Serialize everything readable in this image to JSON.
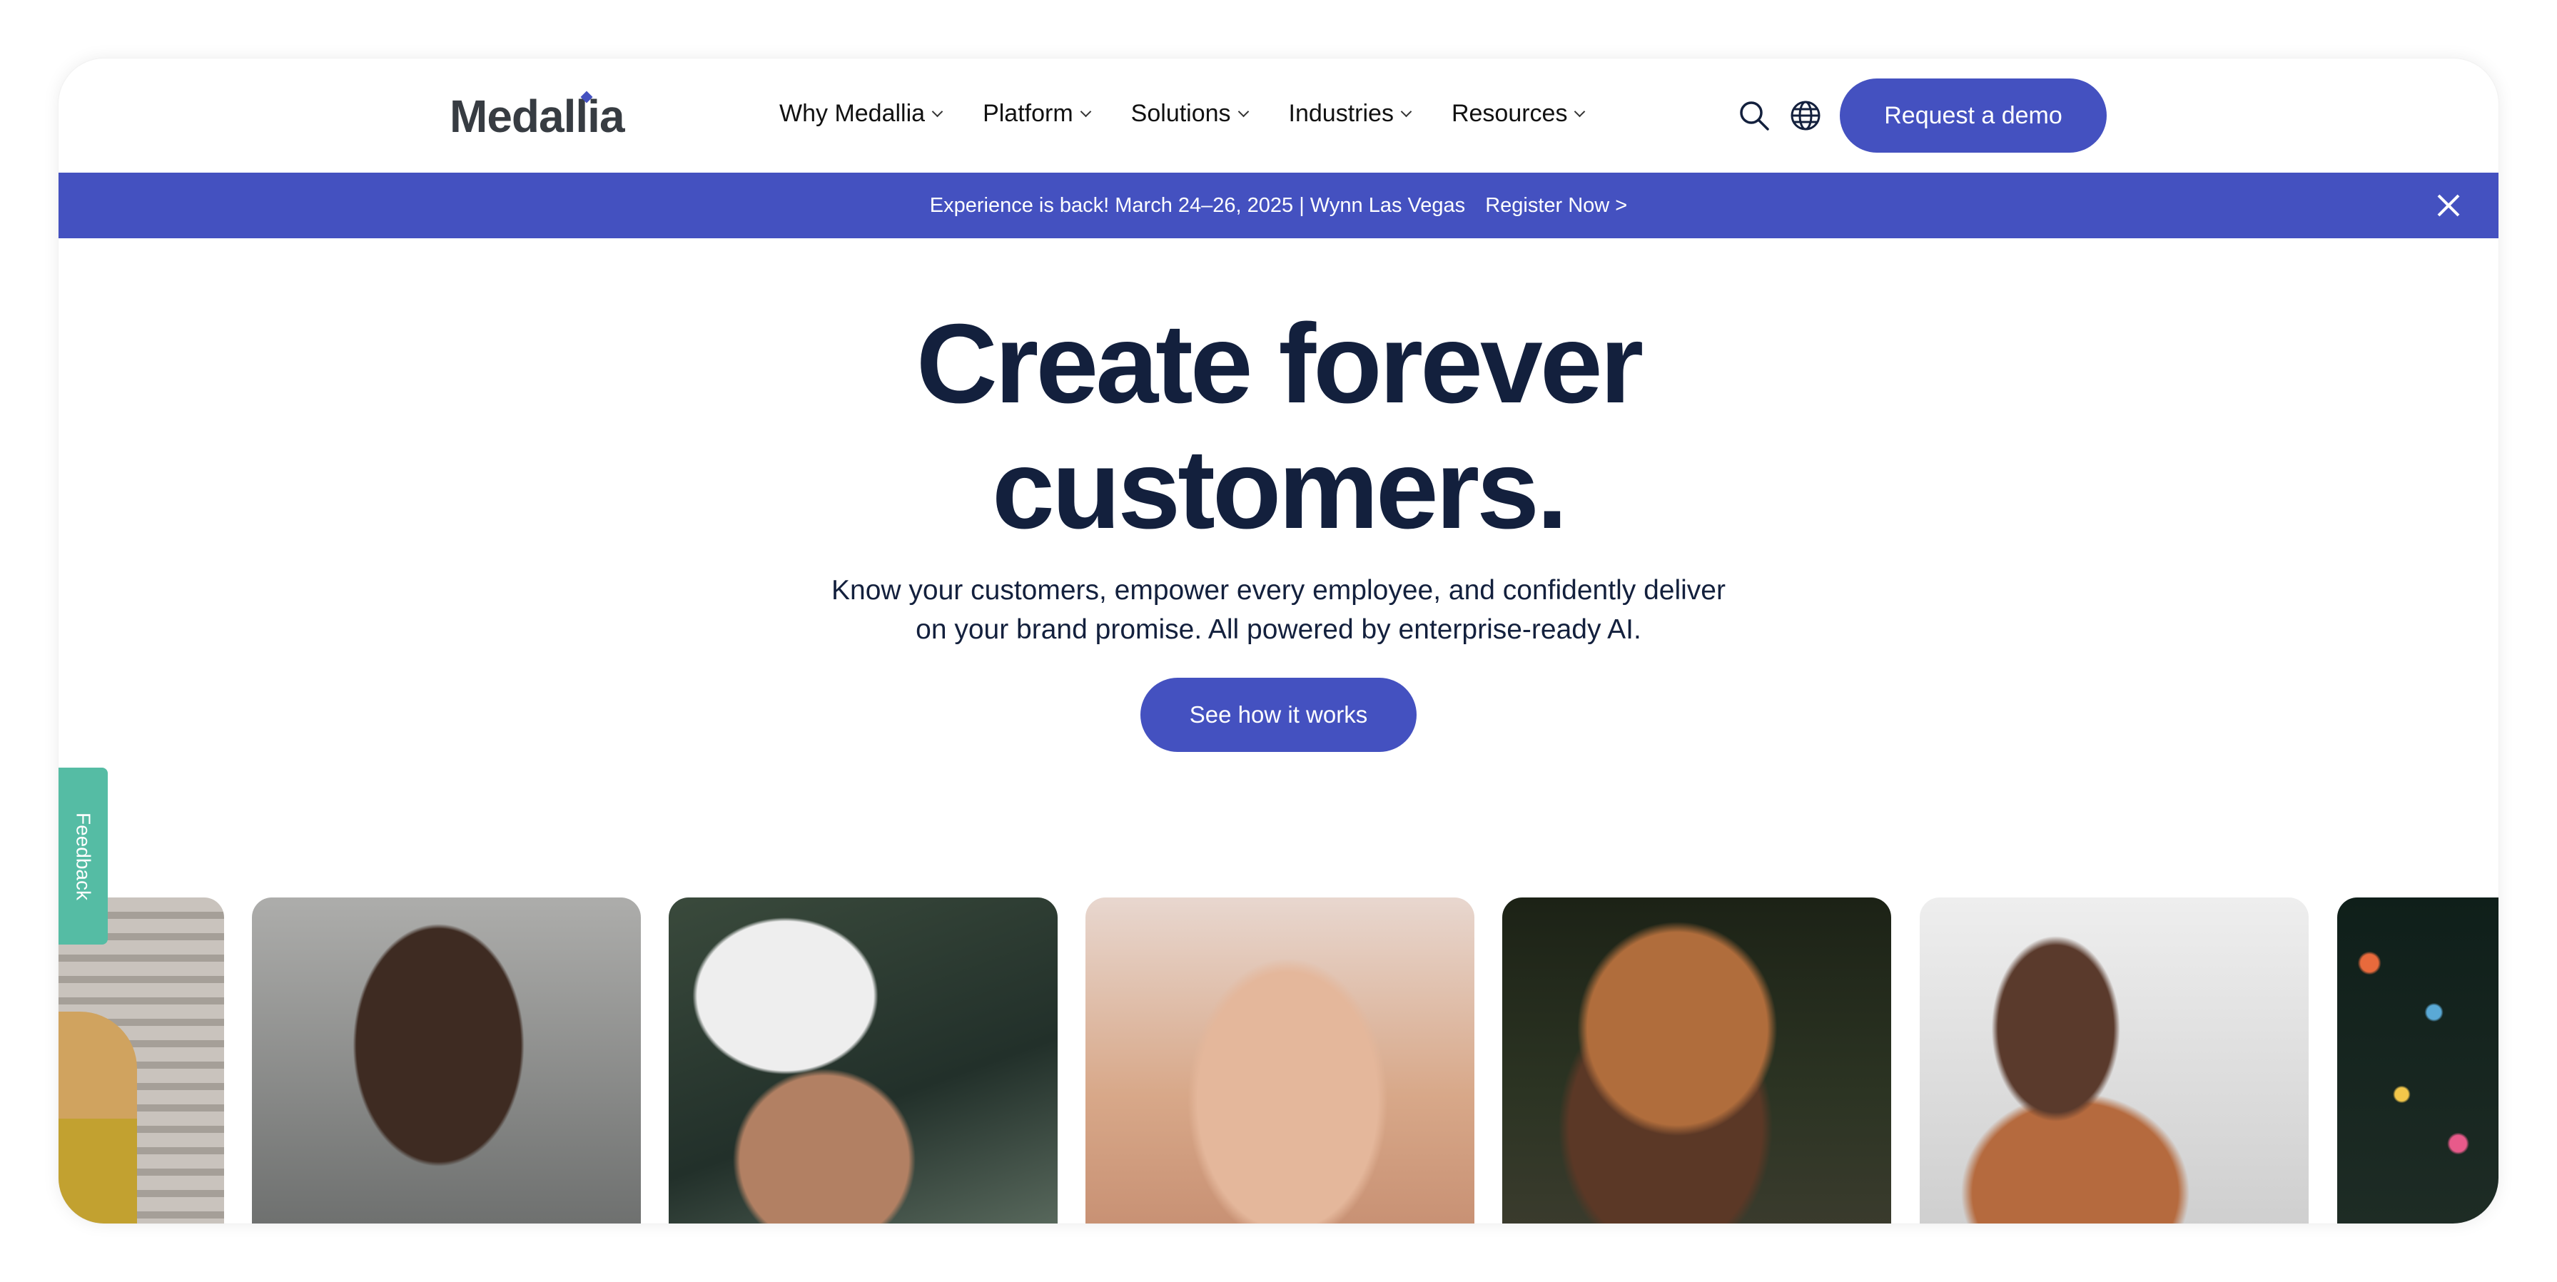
{
  "brand": {
    "logo_text": "Medallia",
    "accent_color": "#4451c0",
    "heading_color": "#13203d",
    "feedback_color": "#55bca4"
  },
  "nav": {
    "items": [
      {
        "label": "Why Medallia"
      },
      {
        "label": "Platform"
      },
      {
        "label": "Solutions"
      },
      {
        "label": "Industries"
      },
      {
        "label": "Resources"
      }
    ],
    "search_icon": "search-icon",
    "globe_icon": "globe-icon",
    "demo_button": "Request a demo"
  },
  "banner": {
    "text": "Experience is back! March 24–26, 2025 | Wynn Las Vegas",
    "link": "Register Now >",
    "close_icon": "close-icon"
  },
  "hero": {
    "title_line1": "Create forever",
    "title_line2": "customers.",
    "subtitle_line1": "Know your customers, empower every employee, and confidently deliver",
    "subtitle_line2": "on your brand promise. All powered by enterprise-ready AI.",
    "cta": "See how it works"
  },
  "feedback": {
    "label": "Feedback"
  },
  "carousel": {
    "cards": [
      {
        "description": "woman in yellow sweater against striped wall (partially visible)"
      },
      {
        "description": "man with braided hair looking aside"
      },
      {
        "description": "smiling cyclist in white helmet"
      },
      {
        "description": "laughing woman with hands in front of face"
      },
      {
        "description": "smiling woman with curly orange hair outdoors"
      },
      {
        "description": "laughing woman with braids holding a bottle"
      },
      {
        "description": "person under falling confetti (partially visible)"
      }
    ]
  }
}
